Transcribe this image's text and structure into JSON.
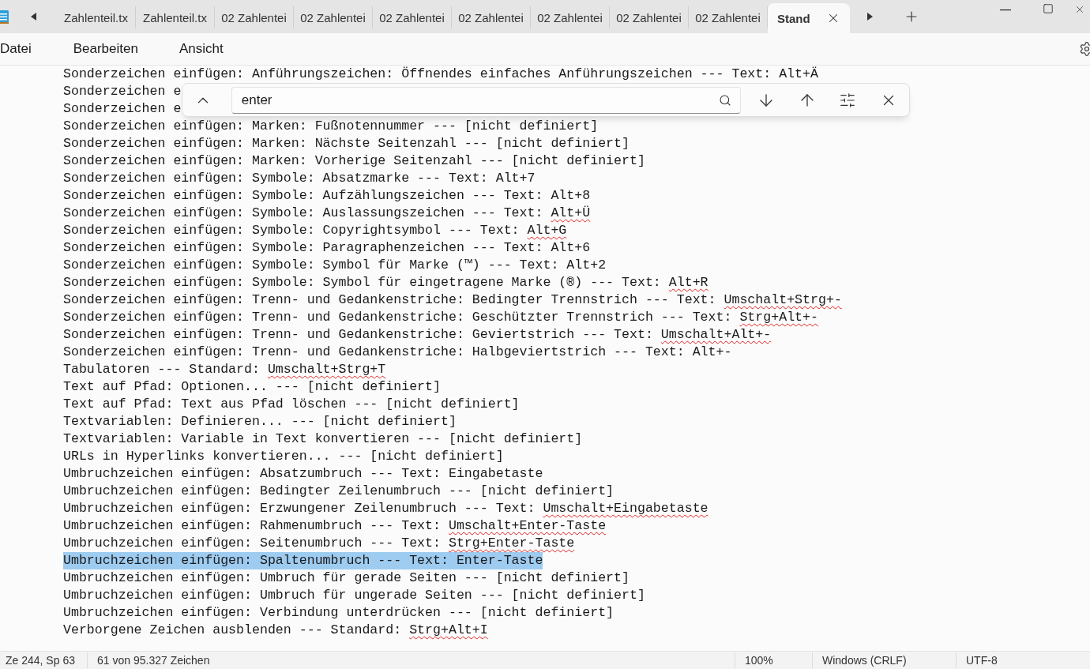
{
  "tabs": [
    {
      "label": "Zahlenteil.tx",
      "selected": false
    },
    {
      "label": "Zahlenteil.tx",
      "selected": false
    },
    {
      "label": "02 Zahlentei",
      "selected": false
    },
    {
      "label": "02 Zahlentei",
      "selected": false
    },
    {
      "label": "02 Zahlentei",
      "selected": false
    },
    {
      "label": "02 Zahlentei",
      "selected": false
    },
    {
      "label": "02 Zahlentei",
      "selected": false
    },
    {
      "label": "02 Zahlentei",
      "selected": false
    },
    {
      "label": "02 Zahlentei",
      "selected": false
    },
    {
      "label": "Stand",
      "selected": true
    }
  ],
  "menu": [
    "Datei",
    "Bearbeiten",
    "Ansicht"
  ],
  "find": {
    "value": "enter"
  },
  "lines": [
    {
      "text": "Sonderzeichen einfügen: Anführungszeichen: Öffnendes einfaches Anführungszeichen --- Text: Alt+Ä",
      "selected": false
    },
    {
      "text": "Sonderzeichen e",
      "selected": false
    },
    {
      "text": "Sonderzeichen e",
      "selected": false
    },
    {
      "text": "Sonderzeichen einfügen: Marken: Fußnotennummer --- [nicht definiert]",
      "selected": false
    },
    {
      "text": "Sonderzeichen einfügen: Marken: Nächste Seitenzahl --- [nicht definiert]",
      "selected": false
    },
    {
      "text": "Sonderzeichen einfügen: Marken: Vorherige Seitenzahl --- [nicht definiert]",
      "selected": false
    },
    {
      "text": "Sonderzeichen einfügen: Symbole: Absatzmarke --- Text: Alt+7",
      "selected": false
    },
    {
      "text": "Sonderzeichen einfügen: Symbole: Aufzählungszeichen --- Text: Alt+8",
      "selected": false
    },
    {
      "text": "Sonderzeichen einfügen: Symbole: Auslassungszeichen --- Text: ",
      "flagged": "Alt+Ü",
      "selected": false
    },
    {
      "text": "Sonderzeichen einfügen: Symbole: Copyrightsymbol --- Text: ",
      "flagged": "Alt+G",
      "selected": false
    },
    {
      "text": "Sonderzeichen einfügen: Symbole: Paragraphenzeichen --- Text: Alt+6",
      "selected": false
    },
    {
      "text": "Sonderzeichen einfügen: Symbole: Symbol für Marke (™) --- Text: Alt+2",
      "selected": false
    },
    {
      "text": "Sonderzeichen einfügen: Symbole: Symbol für eingetragene Marke (®) --- Text: ",
      "flagged": "Alt+R",
      "selected": false
    },
    {
      "text": "Sonderzeichen einfügen: Trenn- und Gedankenstriche: Bedingter Trennstrich --- Text: ",
      "flagged": "Umschalt+Strg+-",
      "selected": false
    },
    {
      "text": "Sonderzeichen einfügen: Trenn- und Gedankenstriche: Geschützter Trennstrich --- Text: ",
      "flagged": "Strg+Alt+-",
      "selected": false
    },
    {
      "text": "Sonderzeichen einfügen: Trenn- und Gedankenstriche: Geviertstrich --- Text: ",
      "flagged": "Umschalt+Alt+-",
      "selected": false
    },
    {
      "text": "Sonderzeichen einfügen: Trenn- und Gedankenstriche: Halbgeviertstrich --- Text: Alt+-",
      "selected": false
    },
    {
      "text": "Tabulatoren --- Standard: ",
      "flagged": "Umschalt+Strg+T",
      "selected": false
    },
    {
      "text": "Text auf Pfad: Optionen... --- [nicht definiert]",
      "selected": false
    },
    {
      "text": "Text auf Pfad: Text aus Pfad löschen --- [nicht definiert]",
      "selected": false
    },
    {
      "text": "Textvariablen: Definieren... --- [nicht definiert]",
      "selected": false
    },
    {
      "text": "Textvariablen: Variable in Text konvertieren --- [nicht definiert]",
      "selected": false
    },
    {
      "text": "URLs in Hyperlinks konvertieren... --- [nicht definiert]",
      "selected": false
    },
    {
      "text": "Umbruchzeichen einfügen: Absatzumbruch --- Text: Eingabetaste",
      "selected": false
    },
    {
      "text": "Umbruchzeichen einfügen: Bedingter Zeilenumbruch --- [nicht definiert]",
      "selected": false
    },
    {
      "text": "Umbruchzeichen einfügen: Erzwungener Zeilenumbruch --- Text: ",
      "flagged": "Umschalt+Eingabetaste",
      "selected": false
    },
    {
      "text": "Umbruchzeichen einfügen: Rahmenumbruch --- Text: ",
      "flagged": "Umschalt+Enter-Taste",
      "selected": false
    },
    {
      "text": "Umbruchzeichen einfügen: Seitenumbruch --- Text: ",
      "flagged": "Strg+Enter-Taste",
      "selected": false
    },
    {
      "text": "Umbruchzeichen einfügen: Spaltenumbruch --- Text: Enter-Taste",
      "selected": true
    },
    {
      "text": "Umbruchzeichen einfügen: Umbruch für gerade Seiten --- [nicht definiert]",
      "selected": false
    },
    {
      "text": "Umbruchzeichen einfügen: Umbruch für ungerade Seiten --- [nicht definiert]",
      "selected": false
    },
    {
      "text": "Umbruchzeichen einfügen: Verbindung unterdrücken --- [nicht definiert]",
      "selected": false
    },
    {
      "text": "Verborgene Zeichen ausblenden --- Standard: ",
      "flagged": "Strg+Alt+I",
      "selected": false
    }
  ],
  "status_bar": {
    "position": "Ze 244, Sp 63",
    "count": "61 von 95.327 Zeichen",
    "zoom": "100%",
    "line_ending": "Windows (CRLF)",
    "encoding": "UTF-8"
  }
}
